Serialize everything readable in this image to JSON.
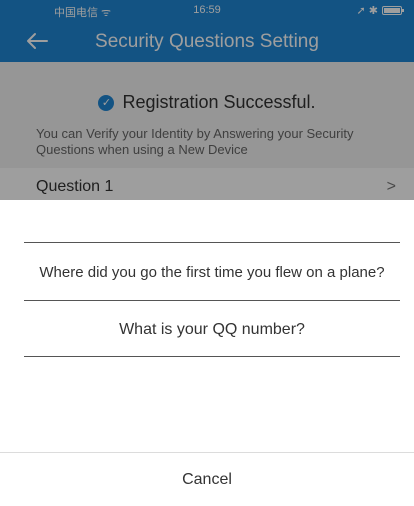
{
  "status_bar": {
    "carrier": "中国电信 ᯤ",
    "time": "16:59",
    "right_icons": "➚ ✱"
  },
  "nav": {
    "title": "Security Questions Setting",
    "back_icon": "arrow-left-icon"
  },
  "content": {
    "success_message": "Registration Successful.",
    "check_icon": "check-circle-icon",
    "info_text": "You can Verify your Identity by Answering your Security Questions when using a New Device",
    "question_label": "Question 1",
    "question_chevron": ">"
  },
  "sheet": {
    "options": [
      "",
      "Where did you go the first time you flew on a plane?",
      "What is your QQ number?"
    ],
    "cancel_label": "Cancel"
  },
  "colors": {
    "primary": "#1f86d4",
    "overlay": "rgba(0,0,0,0.38)"
  }
}
